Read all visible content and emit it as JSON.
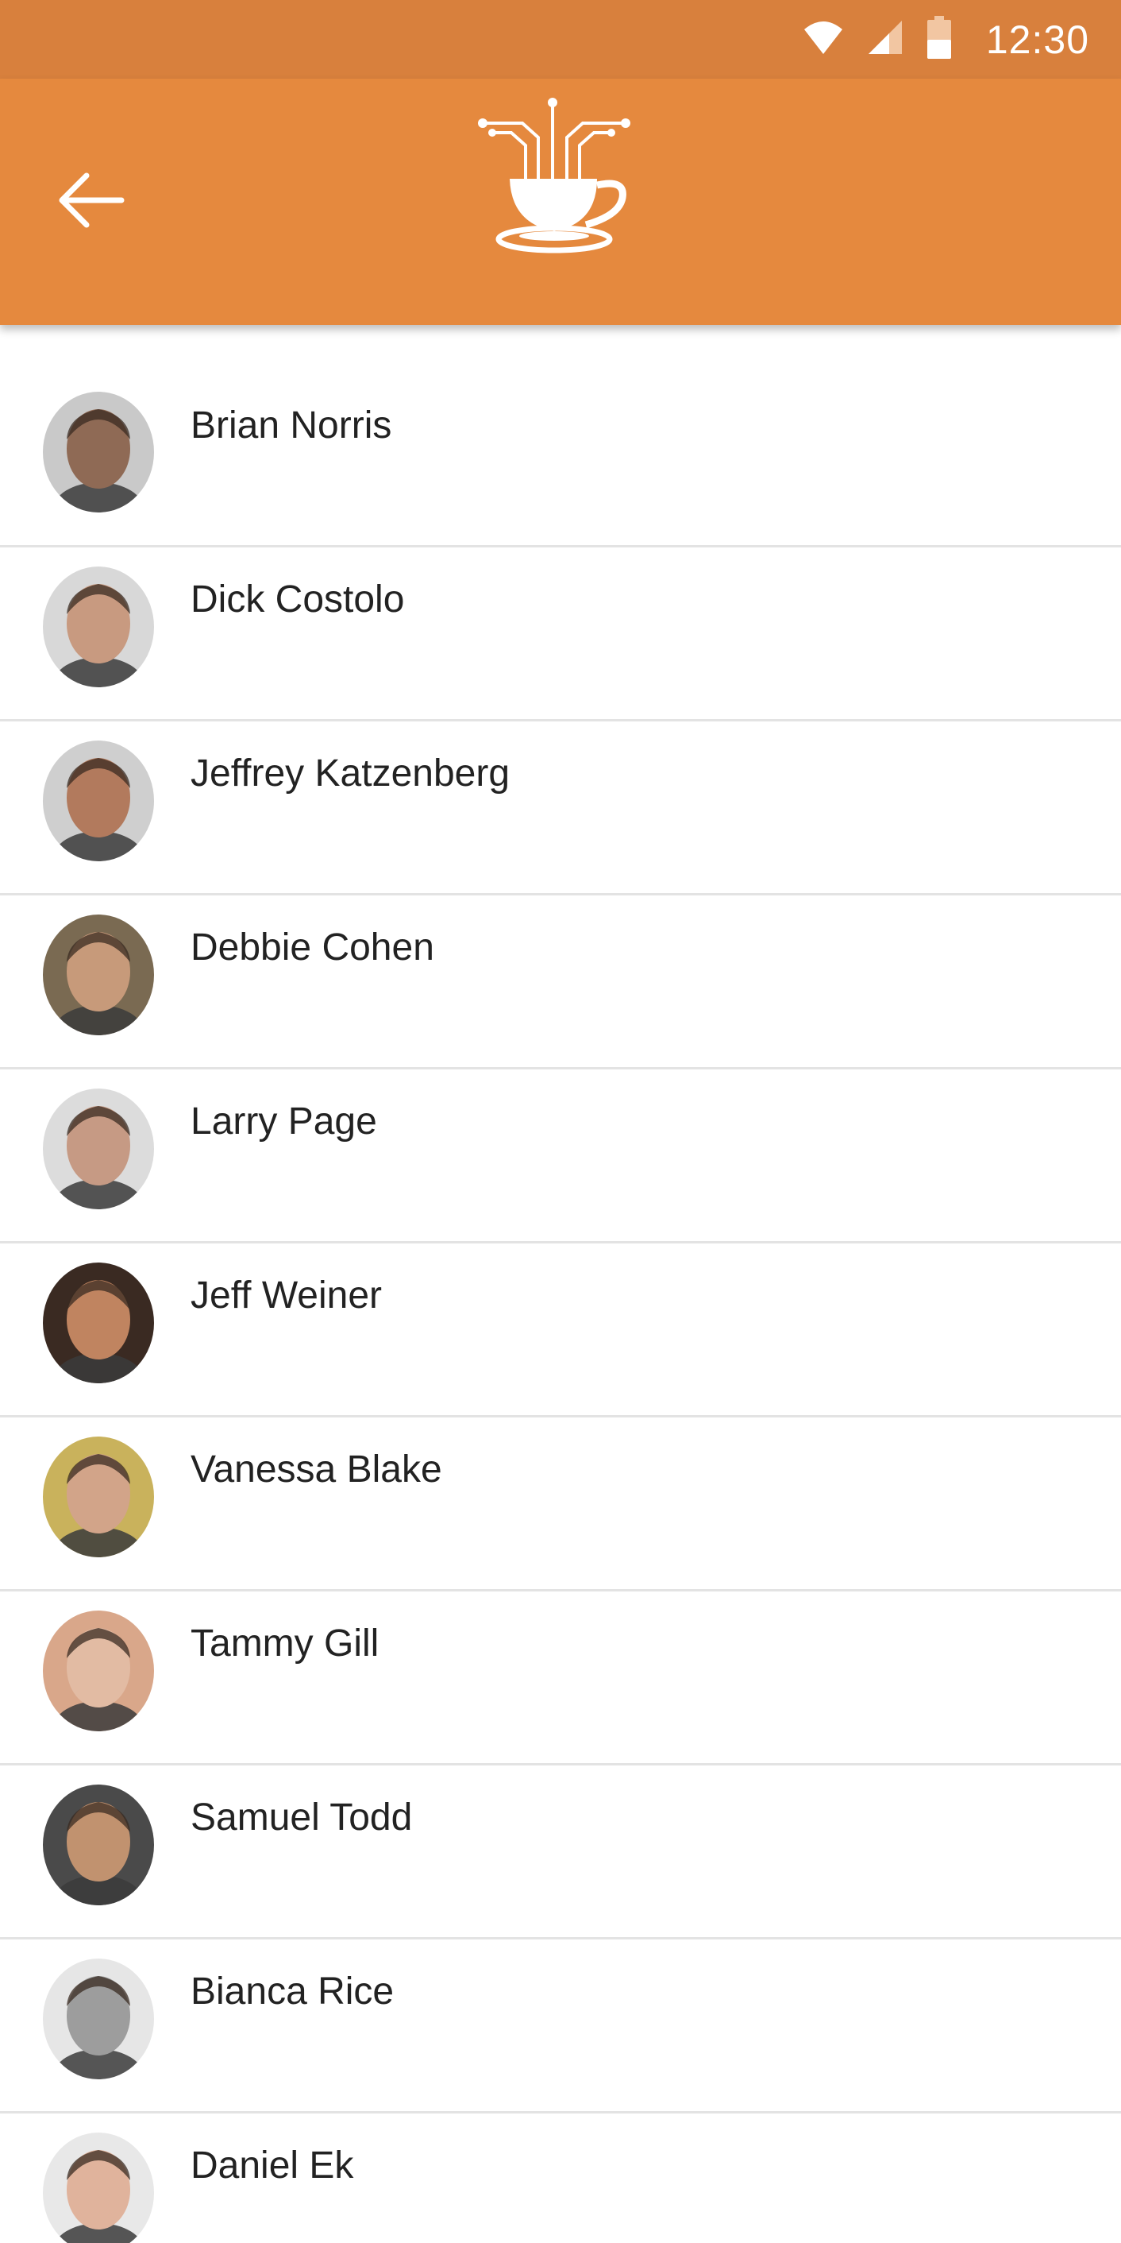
{
  "status_bar": {
    "time": "12:30",
    "icons": [
      "wifi-icon",
      "cell-signal-icon",
      "battery-icon"
    ],
    "color": "#d8803d"
  },
  "app_bar": {
    "color": "#e5893e",
    "back_icon": "arrow-left-icon",
    "logo_icon": "coffee-cup-circuit-logo"
  },
  "contacts": [
    {
      "name": "Brian Norris",
      "avatar_tone": "#8f6a55",
      "bg": "#c9c9c9"
    },
    {
      "name": "Dick Costolo",
      "avatar_tone": "#c89a80",
      "bg": "#d8d8d8"
    },
    {
      "name": "Jeffrey Katzenberg",
      "avatar_tone": "#b27a5d",
      "bg": "#cfcfcf"
    },
    {
      "name": "Debbie Cohen",
      "avatar_tone": "#c79a7a",
      "bg": "#7a6a52"
    },
    {
      "name": "Larry Page",
      "avatar_tone": "#c69a84",
      "bg": "#dcdcdc"
    },
    {
      "name": "Jeff Weiner",
      "avatar_tone": "#c08460",
      "bg": "#3a2a22"
    },
    {
      "name": "Vanessa Blake",
      "avatar_tone": "#d2a489",
      "bg": "#c9b25c"
    },
    {
      "name": "Tammy Gill",
      "avatar_tone": "#e2bba3",
      "bg": "#d9a78a"
    },
    {
      "name": "Samuel Todd",
      "avatar_tone": "#c1926f",
      "bg": "#4a4a4a"
    },
    {
      "name": "Bianca Rice",
      "avatar_tone": "#9d9d9d",
      "bg": "#e6e6e6"
    },
    {
      "name": "Daniel Ek",
      "avatar_tone": "#e0b39c",
      "bg": "#e8e8e8"
    }
  ]
}
